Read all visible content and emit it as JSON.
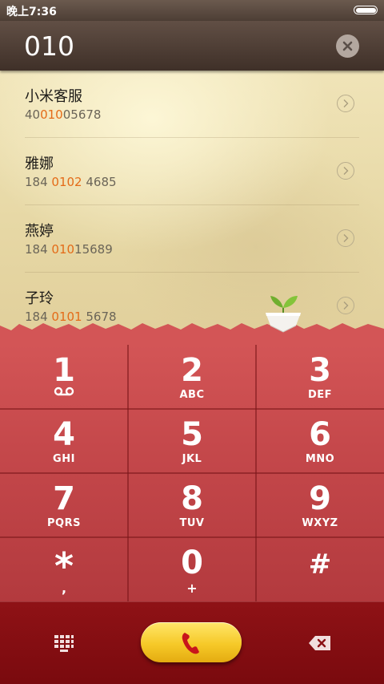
{
  "status_bar": {
    "time": "晚上7:36",
    "battery_level": 1.0
  },
  "dial_input": {
    "value": "010"
  },
  "contacts": [
    {
      "name": "小米客服",
      "number_before": "40",
      "number_match": "010",
      "number_after": "05678"
    },
    {
      "name": "雅娜",
      "number_before": "184 ",
      "number_match": "0102",
      "number_after": " 4685"
    },
    {
      "name": "燕婷",
      "number_before": "184 ",
      "number_match": "010",
      "number_after": "15689"
    },
    {
      "name": "子玲",
      "number_before": "184 ",
      "number_match": "0101",
      "number_after": " 5678"
    }
  ],
  "keys": [
    {
      "digit": "1",
      "letters": ""
    },
    {
      "digit": "2",
      "letters": "ABC"
    },
    {
      "digit": "3",
      "letters": "DEF"
    },
    {
      "digit": "4",
      "letters": "GHI"
    },
    {
      "digit": "5",
      "letters": "JKL"
    },
    {
      "digit": "6",
      "letters": "MNO"
    },
    {
      "digit": "7",
      "letters": "PQRS"
    },
    {
      "digit": "8",
      "letters": "TUV"
    },
    {
      "digit": "9",
      "letters": "WXYZ"
    },
    {
      "digit": "*",
      "letters": ","
    },
    {
      "digit": "0",
      "letters": "+"
    },
    {
      "digit": "#",
      "letters": ""
    }
  ],
  "icons": {
    "clear": "close-icon",
    "detail": "chevron-right-icon",
    "voicemail": "voicemail-icon",
    "dialpad": "dialpad-icon",
    "call": "phone-icon",
    "backspace": "backspace-icon",
    "sprout": "sprout-icon"
  },
  "colors": {
    "match_highlight": "#e46b18",
    "keypad": "#c5484b",
    "bottom_bar": "#8f1216",
    "call_button": "#f6c928",
    "call_icon": "#c8151b"
  }
}
